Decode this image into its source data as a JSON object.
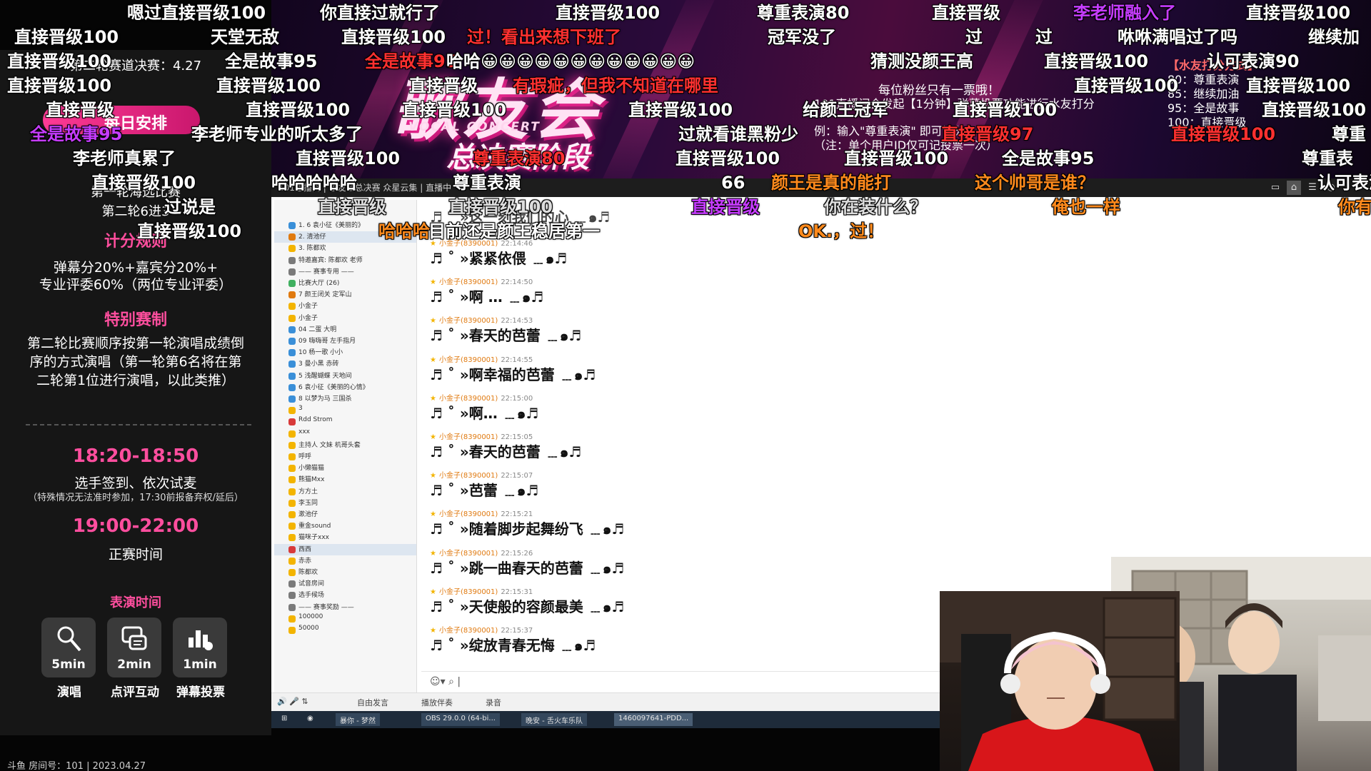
{
  "banner": {
    "title": "歌友会",
    "subtitle": "VOCAL CONCERT",
    "stage": "总决赛阶段",
    "rules_title": "每位粉丝只有一票哦！",
    "rules_line1": "101直播间会发起【1分钟】弹幕投票功能进行水友打分",
    "rules_line2": "例：输入\"尊重表演\" 即可计分",
    "rules_line3": "（注：单个用户ID仅可记投票一次）",
    "vote_title": "【水友打分方式】",
    "vote_lines": [
      "80：尊重表演",
      "85：继续加油",
      "95：全是故事",
      "100：直接晋级"
    ]
  },
  "left_panel": {
    "schedule_tag": "每日安排",
    "finals_label": "第二轮赛道决赛：4.27",
    "round_note_1": "第一轮海选比赛",
    "round_note_2": "第二轮6进3",
    "scoring_title": "计分规则",
    "scoring_line1": "弹幕分20%+嘉宾分20%+",
    "scoring_line2": "专业评委60%（两位专业评委）",
    "special_title": "特别赛制",
    "special_line1": "第二轮比赛顺序按第一轮演唱成绩倒",
    "special_line2": "序的方式演唱（第一轮第6名将在第",
    "special_line3": "二轮第1位进行演唱，以此类推）",
    "time1": "18:20-18:50",
    "time1_desc": "选手签到、依次试麦",
    "time1_note": "（特殊情况无法准时参加，17:30前报备弃权/延后）",
    "time2": "19:00-22:00",
    "time2_desc": "正赛时间",
    "perf_title": "表演时间",
    "tiles": [
      {
        "icon": "microphone-icon",
        "value": "5min",
        "caption": "演唱"
      },
      {
        "icon": "comment-icon",
        "value": "2min",
        "caption": "点评互动"
      },
      {
        "icon": "vote-icon",
        "value": "1min",
        "caption": "弹幕投票"
      }
    ]
  },
  "window": {
    "title": "101直播间 | 歌友会总决赛 众星云集 | 直播中",
    "tree_rows": [
      "1. 6 袁小征《美丽的》",
      "2. 清池仔",
      "3. 陈都欢",
      "特邀嘉宾: 陈都欢 老师",
      "—— 赛事专用 ——",
      "比赛大厅 (26)",
      "7 颜王闭关 定军山",
      "小金子",
      "小金子",
      "04 二蛋 大明",
      "09 嗨嗨哥 左手指月",
      "10 杨一歌 小小",
      "3 曼小黑 赤砖",
      "5 浅醒蝴蝶 天地间",
      "6 袁小征《美丽的心情》",
      "8 以梦为马 三国杀",
      "3",
      "Rdd Strom",
      "xxx",
      "主持人 文妹 机哥头套",
      "呼呼",
      "小懒猫猫",
      "熊猫Mxx",
      "方方土",
      "李玉同",
      "漱池仔",
      "重金sound",
      "猫咪子xxx",
      "西西",
      "赤赤",
      "陈都欢",
      "试音房间",
      "选手候场",
      "—— 赛事奖励 ——",
      "100000",
      "50000"
    ],
    "messages": [
      {
        "user": "小金子",
        "id": "(8390001)",
        "time": "22:14:46",
        "text": "♬ ˚ »紧紧依偎 ﹍๑♬"
      },
      {
        "user": "小金子",
        "id": "(8390001)",
        "time": "22:14:50",
        "text": "♬ ˚ »啊 … ﹍๑♬"
      },
      {
        "user": "小金子",
        "id": "(8390001)",
        "time": "22:14:53",
        "text": "♬ ˚ »春天的芭蕾 ﹍๑♬"
      },
      {
        "user": "小金子",
        "id": "(8390001)",
        "time": "22:14:55",
        "text": "♬ ˚ »啊幸福的芭蕾 ﹍๑♬"
      },
      {
        "user": "小金子",
        "id": "(8390001)",
        "time": "22:15:00",
        "text": "♬ ˚ »啊… ﹍๑♬"
      },
      {
        "user": "小金子",
        "id": "(8390001)",
        "time": "22:15:05",
        "text": "♬ ˚ »春天的芭蕾 ﹍๑♬"
      },
      {
        "user": "小金子",
        "id": "(8390001)",
        "time": "22:15:07",
        "text": "♬ ˚ »芭蕾 ﹍๑♬"
      },
      {
        "user": "小金子",
        "id": "(8390001)",
        "time": "22:15:21",
        "text": "♬ ˚ »随着脚步起舞纷飞 ﹍๑♬"
      },
      {
        "user": "小金子",
        "id": "(8390001)",
        "time": "22:15:26",
        "text": "♬ ˚ »跳一曲春天的芭蕾 ﹍๑♬"
      },
      {
        "user": "小金子",
        "id": "(8390001)",
        "time": "22:15:31",
        "text": "♬ ˚ »天使般的容颜最美 ﹍๑♬"
      },
      {
        "user": "小金子",
        "id": "(8390001)",
        "time": "22:15:37",
        "text": "♬ ˚ »绽放青春无悔 ﹍๑♬"
      }
    ],
    "first_msg_partial": "♬ ˚ »这一刻我们的心 ﹍๑♬",
    "bottombar": [
      "自由发言",
      "播放伴奏",
      "录音"
    ],
    "taskbar": [
      "暴你 - 梦然",
      "OBS 29.0.0 (64-bi...",
      "晚安 - 舌火车乐队",
      "1460097641-PDD..."
    ]
  },
  "danmaku": [
    {
      "text": "嗯过直接晋级100",
      "color": "white"
    },
    {
      "text": "你直接过就行了",
      "color": "white"
    },
    {
      "text": "直接晋级100",
      "color": "white"
    },
    {
      "text": "尊重表演80",
      "color": "white"
    },
    {
      "text": "直接晋级",
      "color": "white"
    },
    {
      "text": "李老师融入了",
      "color": "purple"
    },
    {
      "text": "直接晋级100",
      "color": "white"
    },
    {
      "text": "直接晋级100",
      "color": "white"
    },
    {
      "text": "天堂无敌",
      "color": "white"
    },
    {
      "text": "直接晋级100",
      "color": "white"
    },
    {
      "text": "过！看出来想下班了",
      "color": "red"
    },
    {
      "text": "冠军没了",
      "color": "white"
    },
    {
      "text": "过",
      "color": "white"
    },
    {
      "text": "过",
      "color": "white"
    },
    {
      "text": "咻咻满唱过了吗",
      "color": "white"
    },
    {
      "text": "继续加",
      "color": "white"
    },
    {
      "text": "直接晋级100",
      "color": "white"
    },
    {
      "text": "全是故事95",
      "color": "white"
    },
    {
      "text": "全是故事95",
      "color": "red"
    },
    {
      "text": "哈哈😀😀😀😀😀😀😀😀😀😀😀😀",
      "color": "white"
    },
    {
      "text": "猜测没颜王高",
      "color": "white"
    },
    {
      "text": "直接晋级100",
      "color": "white"
    },
    {
      "text": "认可表演90",
      "color": "white"
    },
    {
      "text": "直接晋级100",
      "color": "white"
    },
    {
      "text": "直接晋级100",
      "color": "white"
    },
    {
      "text": "直接晋级",
      "color": "white"
    },
    {
      "text": "有瑕疵，但我不知道在哪里",
      "color": "red"
    },
    {
      "text": "直接晋级100",
      "color": "white"
    },
    {
      "text": "直接晋级100",
      "color": "white"
    },
    {
      "text": "直接晋级",
      "color": "white"
    },
    {
      "text": "直接晋级100",
      "color": "white"
    },
    {
      "text": "直接晋级100",
      "color": "white"
    },
    {
      "text": "直接晋级100",
      "color": "white"
    },
    {
      "text": "给颜王冠军",
      "color": "white"
    },
    {
      "text": "直接晋级100",
      "color": "white"
    },
    {
      "text": "直接晋级100",
      "color": "white"
    },
    {
      "text": "全是故事95",
      "color": "purple"
    },
    {
      "text": "李老师专业的听太多了",
      "color": "white"
    },
    {
      "text": "过就看谁黑粉少",
      "color": "white"
    },
    {
      "text": "直接晋级97",
      "color": "red"
    },
    {
      "text": "直接晋级100",
      "color": "red"
    },
    {
      "text": "尊重",
      "color": "white"
    },
    {
      "text": "李老师真累了",
      "color": "white"
    },
    {
      "text": "直接晋级100",
      "color": "white"
    },
    {
      "text": "尊重表演80",
      "color": "red"
    },
    {
      "text": "直接晋级100",
      "color": "white"
    },
    {
      "text": "直接晋级100",
      "color": "white"
    },
    {
      "text": "全是故事95",
      "color": "white"
    },
    {
      "text": "尊重表",
      "color": "white"
    },
    {
      "text": "直接晋级100",
      "color": "white"
    },
    {
      "text": "哈哈哈哈哈",
      "color": "white"
    },
    {
      "text": "尊重表演",
      "color": "white"
    },
    {
      "text": "66",
      "color": "white"
    },
    {
      "text": "颜王是真的能打",
      "color": "orange"
    },
    {
      "text": "这个帅哥是谁？",
      "color": "orange"
    },
    {
      "text": "认可表演",
      "color": "white"
    },
    {
      "text": "过说是",
      "color": "white"
    },
    {
      "text": "直接晋级",
      "color": "grey"
    },
    {
      "text": "直接晋级100",
      "color": "grey"
    },
    {
      "text": "直接晋级",
      "color": "purple"
    },
    {
      "text": "你在装什么？",
      "color": "grey"
    },
    {
      "text": "俺也一样",
      "color": "orange"
    },
    {
      "text": "你有",
      "color": "orange"
    },
    {
      "text": "直接晋级100",
      "color": "white"
    },
    {
      "text": "哈哈哈",
      "color": "orange"
    },
    {
      "text": "目前还是颜王稳居第一",
      "color": "white"
    },
    {
      "text": "OK.，过！",
      "color": "orange"
    }
  ],
  "footer": "斗鱼 房间号：101 | 2023.04.27"
}
